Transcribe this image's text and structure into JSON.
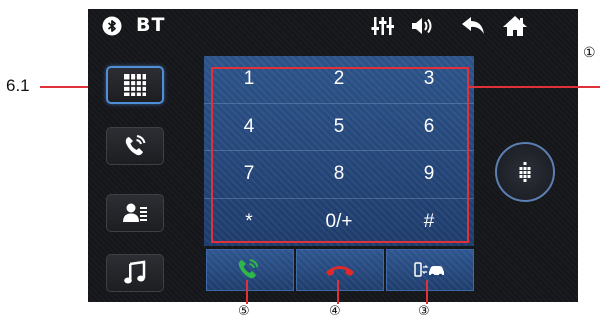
{
  "statusbar": {
    "source_label": "BT",
    "icons": [
      "bluetooth-icon",
      "equalizer-icon",
      "volume-icon",
      "back-icon",
      "home-icon"
    ]
  },
  "side_buttons": [
    {
      "icon": "keypad-icon",
      "active": true
    },
    {
      "icon": "call-log-icon",
      "active": false
    },
    {
      "icon": "contacts-icon",
      "active": false
    },
    {
      "icon": "music-icon",
      "active": false
    }
  ],
  "keypad": {
    "keys": [
      "1",
      "2",
      "3",
      "4",
      "5",
      "6",
      "7",
      "8",
      "9",
      "*",
      "0/+",
      "#"
    ]
  },
  "call_buttons": [
    {
      "icon": "answer-call-icon",
      "color": "#2fb84a"
    },
    {
      "icon": "hang-up-icon",
      "color": "#e02a2a"
    },
    {
      "icon": "transfer-audio-icon",
      "color": "#ffffff"
    }
  ],
  "round_button": {
    "icon": "keypad-toggle-icon"
  },
  "annotations": {
    "side_label": "6.1",
    "right_label": "①",
    "bottom_labels": [
      "⑤",
      "④",
      "③"
    ]
  },
  "colors": {
    "screen_bg": "#15161a",
    "keypad_blue": "#2a4f86",
    "highlight_red": "#e0313b",
    "active_border": "#4f8fd8"
  }
}
